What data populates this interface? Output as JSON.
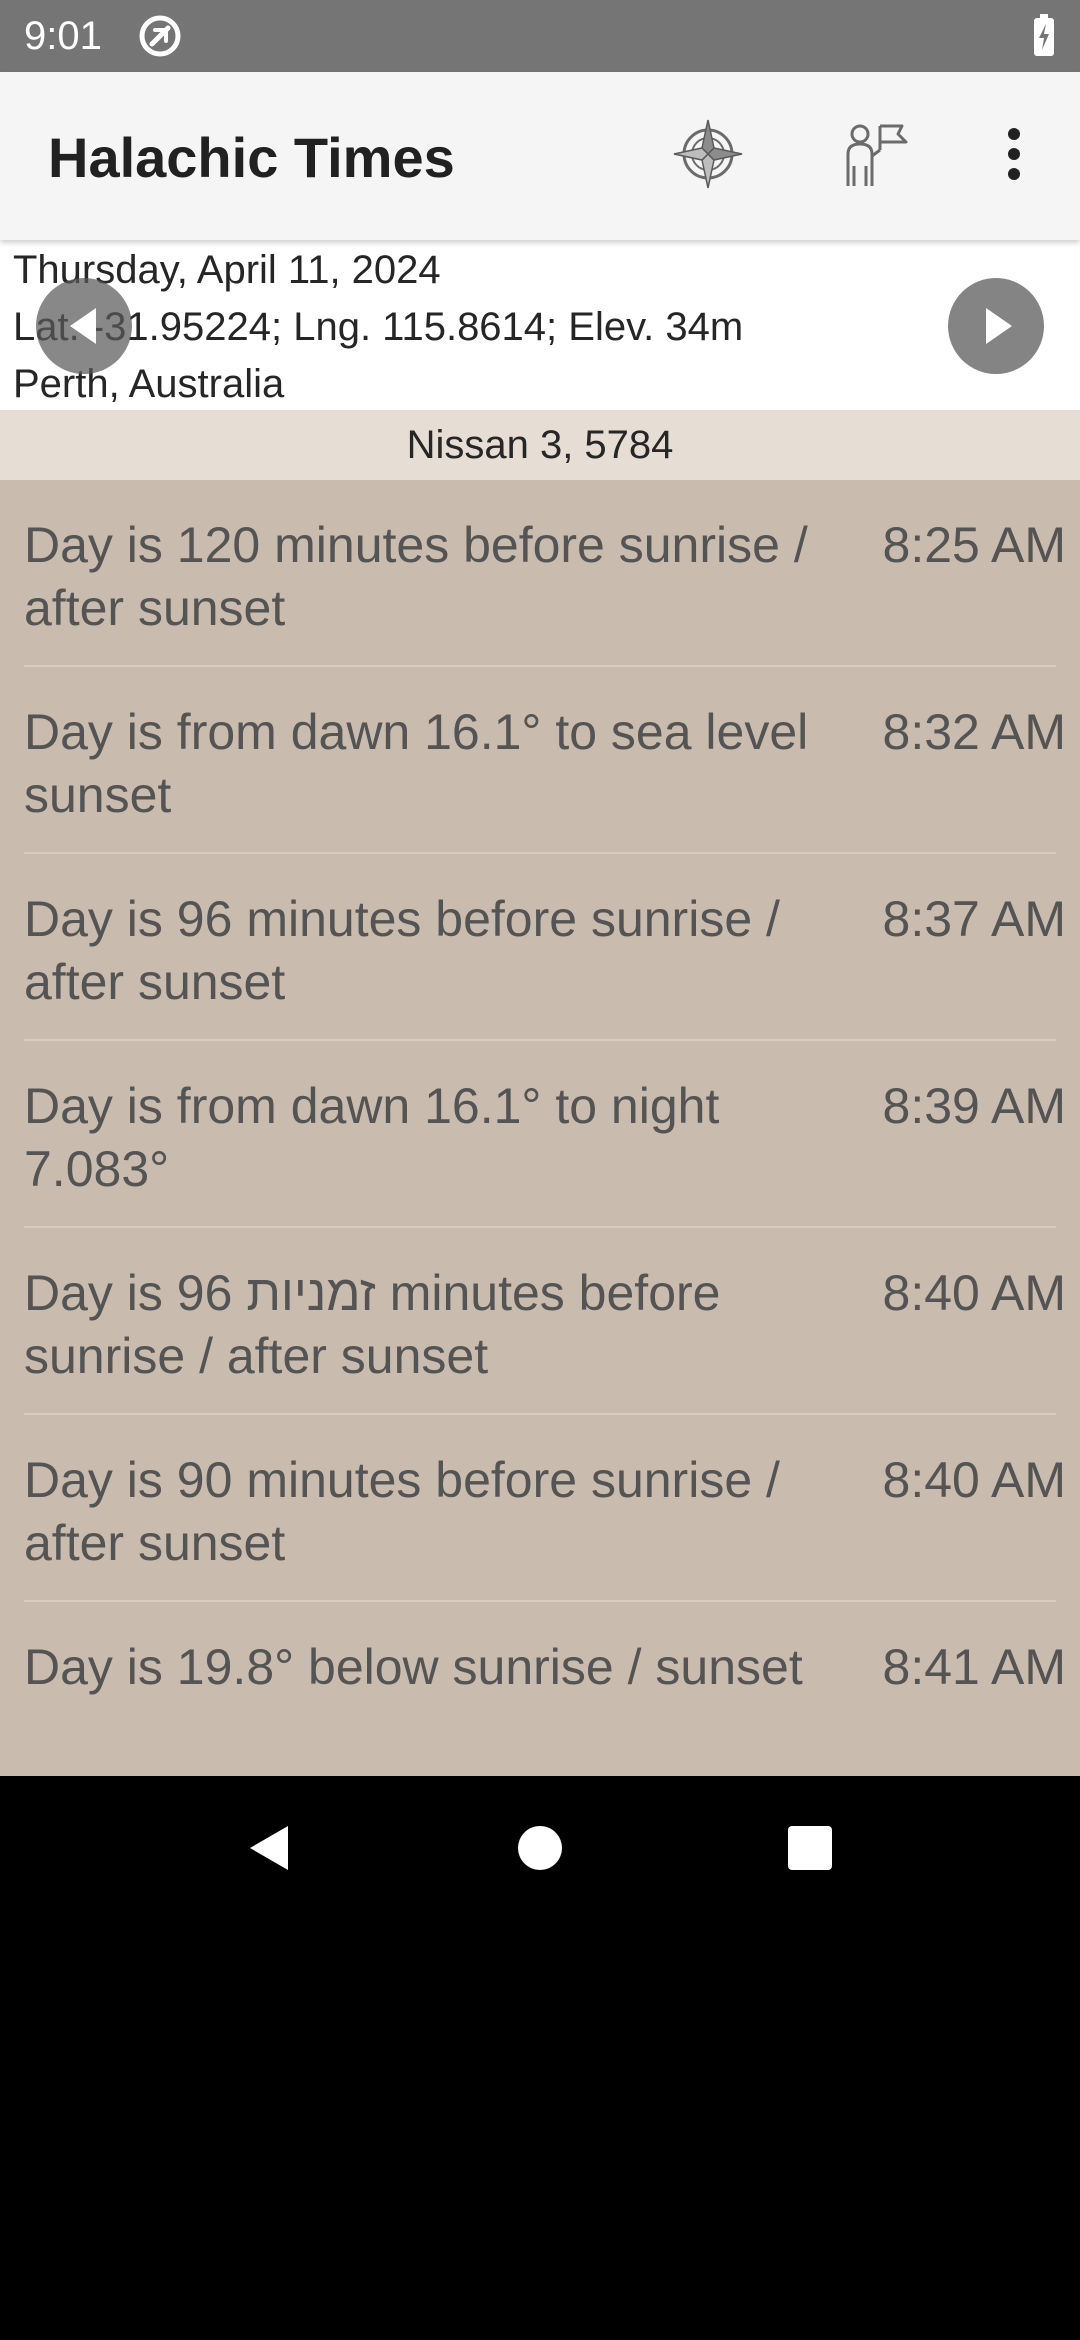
{
  "status_bar": {
    "time": "9:01",
    "notification_icon": "at-sign-icon",
    "battery_icon": "battery-charging-icon"
  },
  "app_bar": {
    "title": "Halachic Times",
    "actions": [
      {
        "name": "compass-icon",
        "label": "Compass"
      },
      {
        "name": "zmanim-icon",
        "label": "Zmanim"
      },
      {
        "name": "more-vert-icon",
        "label": "More options"
      }
    ]
  },
  "header": {
    "date": "Thursday, April 11, 2024",
    "coordinates": "Lat. -31.95224; Lng. 115.8614; Elev. 34m",
    "location": "Perth, Australia",
    "prev_icon": "chevron-left-icon",
    "next_icon": "chevron-right-icon"
  },
  "hebrew_date": "Nissan 3, 5784",
  "zmanim": [
    {
      "label": "Day is 120 minutes before sunrise / after sunset",
      "time": "8:25 AM"
    },
    {
      "label": "Day is from dawn 16.1° to sea level sunset",
      "time": "8:32 AM"
    },
    {
      "label": "Day is 96 minutes before sunrise / after sunset",
      "time": "8:37 AM"
    },
    {
      "label": "Day is from dawn 16.1° to night 7.083°",
      "time": "8:39 AM"
    },
    {
      "label": "Day is 96 זמניות minutes before sunrise / after sunset",
      "time": "8:40 AM"
    },
    {
      "label": "Day is 90 minutes before sunrise / after sunset",
      "time": "8:40 AM"
    },
    {
      "label": "Day is 19.8° below sunrise / sunset",
      "time": "8:41 AM"
    }
  ],
  "system_nav": {
    "back": "back-triangle-icon",
    "home": "home-circle-icon",
    "recents": "recents-square-icon"
  },
  "colors": {
    "status_bar": "#757575",
    "app_bar": "#f5f5f5",
    "list_background": "#c9bcaf",
    "hebrew_bar": "#e6ddd5",
    "text": "#545454"
  }
}
